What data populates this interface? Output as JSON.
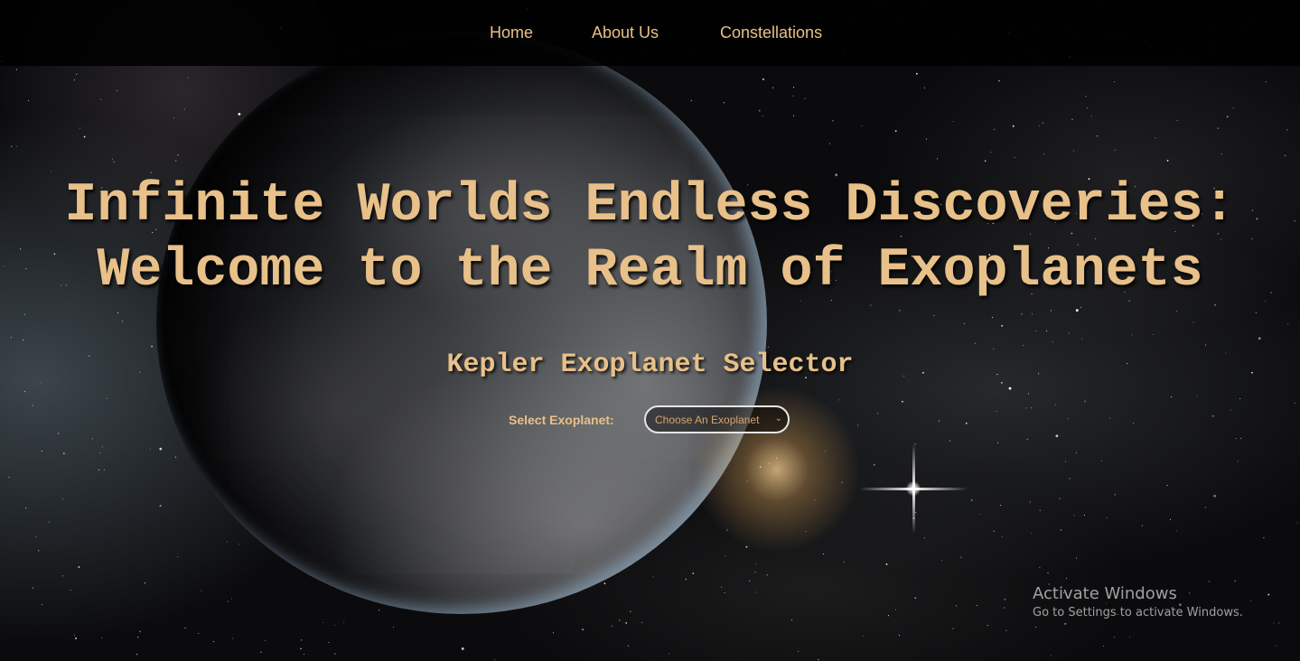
{
  "nav": {
    "items": [
      {
        "label": "Home"
      },
      {
        "label": "About Us"
      },
      {
        "label": "Constellations"
      }
    ]
  },
  "hero": {
    "headline_line1": "Infinite Worlds Endless Discoveries:",
    "headline_line2": "Welcome to the Realm of Exoplanets",
    "subheading": "Kepler Exoplanet Selector"
  },
  "selector": {
    "label": "Select Exoplanet:",
    "selected_value": "Choose An Exoplanet",
    "chevron": "⌄"
  },
  "watermark": {
    "title": "Activate Windows",
    "subtitle": "Go to Settings to activate Windows."
  },
  "colors": {
    "accent": "#e8c089",
    "navbar_bg": "#000000",
    "select_border": "#e6e6e6"
  },
  "icons": {
    "select_chevron": "chevron-down-icon"
  }
}
